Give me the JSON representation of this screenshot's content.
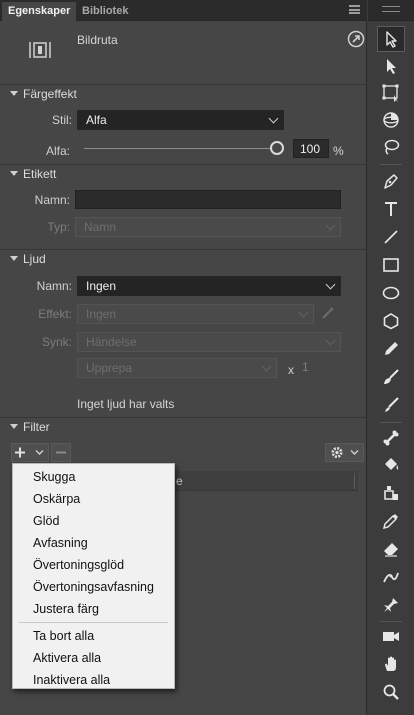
{
  "tabs": {
    "active": "Egenskaper",
    "inactive": "Bibliotek"
  },
  "object": {
    "type_label": "Bildruta"
  },
  "color_effect": {
    "title": "Färgeffekt",
    "style_label": "Stil:",
    "style_value": "Alfa",
    "alpha_label": "Alfa:",
    "alpha_value": "100",
    "alpha_unit": "%",
    "alpha_level": 1.0
  },
  "label_section": {
    "title": "Etikett",
    "name_label": "Namn:",
    "name_value": "",
    "type_label": "Typ:",
    "type_value": "Namn"
  },
  "sound": {
    "title": "Ljud",
    "name_label": "Namn:",
    "name_value": "Ingen",
    "effect_label": "Effekt:",
    "effect_value": "Ingen",
    "sync_label": "Synk:",
    "sync_value": "Händelse",
    "repeat_value": "Upprepa",
    "repeat_x": "x",
    "repeat_count": "1",
    "status": "Inget ljud har valts"
  },
  "filter": {
    "title": "Filter",
    "column_header_fragment": "e"
  },
  "filter_menu": {
    "items": [
      "Skugga",
      "Oskärpa",
      "Glöd",
      "Avfasning",
      "Övertoningsglöd",
      "Övertoningsavfasning",
      "Justera färg"
    ],
    "actions": [
      "Ta bort alla",
      "Aktivera alla",
      "Inaktivera alla"
    ]
  },
  "tools": [
    "selection-tool-icon",
    "subselection-tool-icon",
    "free-transform-tool-icon",
    "3d-rotation-tool-icon",
    "lasso-tool-icon",
    "pen-tool-icon",
    "text-tool-icon",
    "line-tool-icon",
    "rectangle-tool-icon",
    "oval-tool-icon",
    "polystar-tool-icon",
    "pencil-tool-icon",
    "paint-brush-tool-icon",
    "brush-tool-icon",
    "bone-tool-icon",
    "paint-bucket-tool-icon",
    "ink-bottle-tool-icon",
    "eyedropper-tool-icon",
    "eraser-tool-icon",
    "width-tool-icon",
    "asset-warp-tool-icon",
    "camera-tool-icon",
    "hand-tool-icon",
    "zoom-tool-icon"
  ]
}
